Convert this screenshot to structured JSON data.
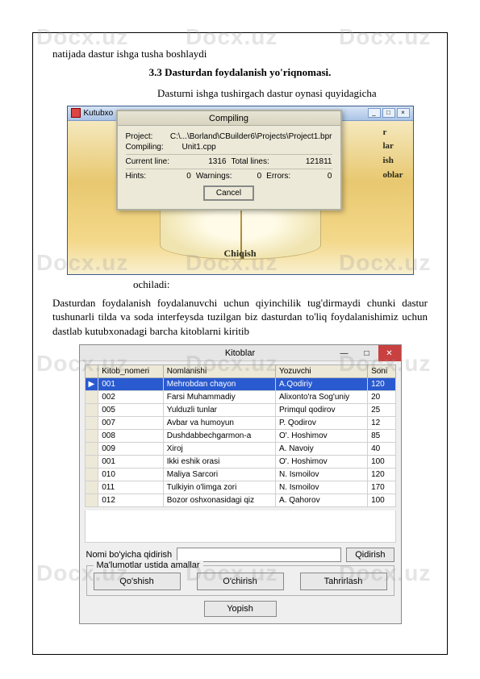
{
  "watermark": "Docx.uz",
  "text": {
    "line1": "natijada dastur ishga tusha boshlaydi",
    "heading": "3.3 Dasturdan foydalanish yo'riqnomasi.",
    "line2": "Dasturni ishga tushirgach dastur oynasi quyidagicha",
    "ochiladi": "ochiladi:",
    "para2": "Dasturdan foydalanish foydalanuvchi uchun qiyinchilik tug'dirmaydi chunki dastur tushunarli tilda va soda interfeysda tuzilgan biz dasturdan to'liq foydalanishimiz uchun dastlab kutubxonadagi barcha kitoblarni kiritib"
  },
  "shot1": {
    "app_title": "Kutubxo",
    "menu": {
      "m1": "r",
      "m2": "lar",
      "m3": "ish",
      "m4": "oblar"
    },
    "chiqish": "Chiqish",
    "compile": {
      "title": "Compiling",
      "project_lbl": "Project:",
      "project_val": "C:\\...\\Borland\\CBuilder6\\Projects\\Project1.bpr",
      "compiling_lbl": "Compiling:",
      "compiling_val": "Unit1.cpp",
      "curline_lbl": "Current line:",
      "curline_val": "1316",
      "totline_lbl": "Total lines:",
      "totline_val": "121811",
      "hints_lbl": "Hints:",
      "hints_val": "0",
      "warn_lbl": "Warnings:",
      "warn_val": "0",
      "err_lbl": "Errors:",
      "err_val": "0",
      "cancel": "Cancel"
    }
  },
  "shot2": {
    "title": "Kitoblar",
    "cols": {
      "c1": "Kitob_nomeri",
      "c2": "Nomlanishi",
      "c3": "Yozuvchi",
      "c4": "Soni"
    },
    "rows": [
      {
        "n": "001",
        "name": "Mehrobdan chayon",
        "auth": "A.Qodiriy",
        "q": "120"
      },
      {
        "n": "002",
        "name": "Farsi Muhammadiy",
        "auth": "Alixonto'ra Sog'uniy",
        "q": "20"
      },
      {
        "n": "005",
        "name": "Yulduzli tunlar",
        "auth": "Primqul qodirov",
        "q": "25"
      },
      {
        "n": "007",
        "name": "Avbar va humoyun",
        "auth": "P. Qodirov",
        "q": "12"
      },
      {
        "n": "008",
        "name": "Dushdabbechgarmon-a",
        "auth": "O'. Hoshimov",
        "q": "85"
      },
      {
        "n": "009",
        "name": "Xiroj",
        "auth": "A. Navoiy",
        "q": "40"
      },
      {
        "n": "001",
        "name": "Ikki eshik orasi",
        "auth": "O'. Hoshimov",
        "q": "100"
      },
      {
        "n": "010",
        "name": "Maliya Sarcori",
        "auth": "N. Ismoilov",
        "q": "120"
      },
      {
        "n": "011",
        "name": "Tulkiyin o'limga zori",
        "auth": "N. Ismoilov",
        "q": "170"
      },
      {
        "n": "012",
        "name": "Bozor oshxonasidagi qiz",
        "auth": "A. Qahorov",
        "q": "100"
      }
    ],
    "search_lbl": "Nomi bo'yicha qidirish",
    "search_btn": "Qidirish",
    "group_legend": "Ma'lumotlar ustida amallar",
    "btn_add": "Qo'shish",
    "btn_del": "O'chirish",
    "btn_edit": "Tahrirlash",
    "btn_close": "Yopish"
  }
}
